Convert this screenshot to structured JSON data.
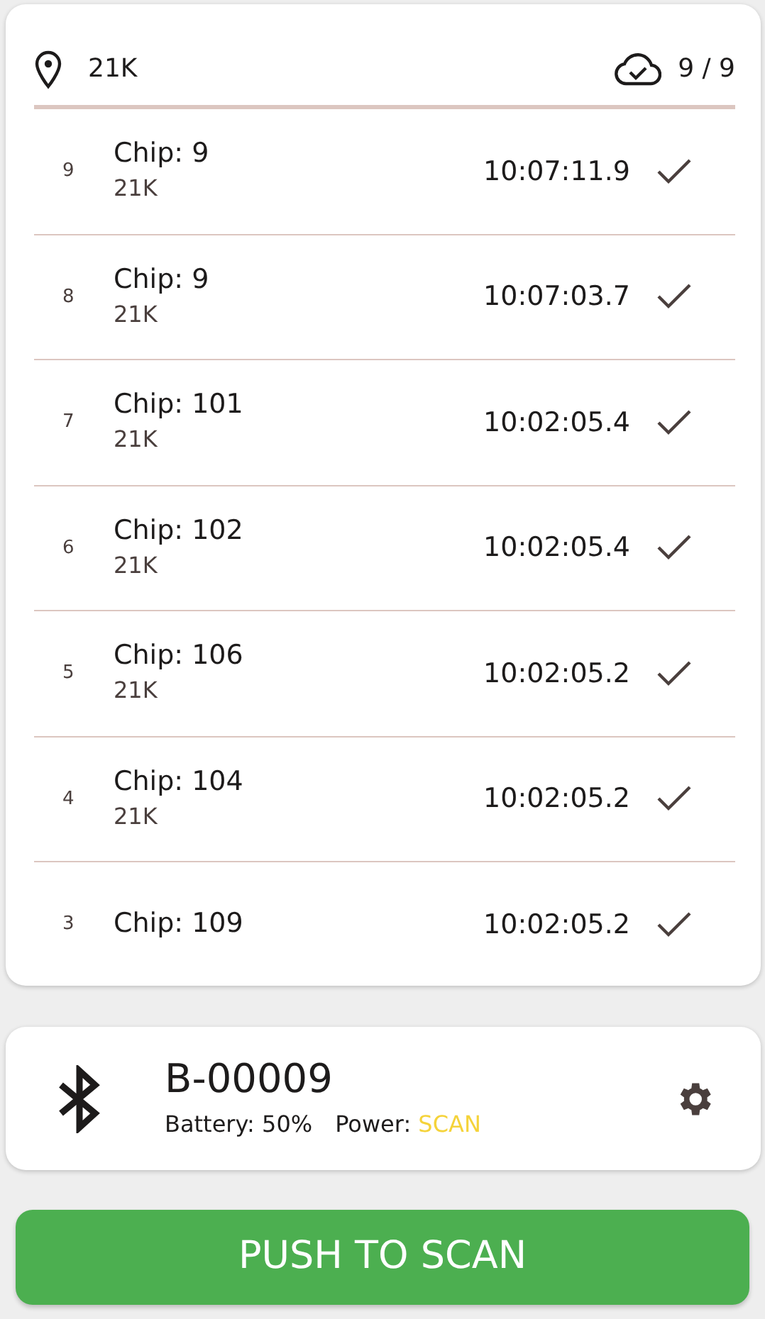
{
  "header": {
    "location": "21K",
    "sync_count": "9 / 9"
  },
  "reads": [
    {
      "index": "9",
      "chip": "Chip: 9",
      "location": "21K",
      "time": "10:07:11.9",
      "synced": true
    },
    {
      "index": "8",
      "chip": "Chip: 9",
      "location": "21K",
      "time": "10:07:03.7",
      "synced": true
    },
    {
      "index": "7",
      "chip": "Chip: 101",
      "location": "21K",
      "time": "10:02:05.4",
      "synced": true
    },
    {
      "index": "6",
      "chip": "Chip: 102",
      "location": "21K",
      "time": "10:02:05.4",
      "synced": true
    },
    {
      "index": "5",
      "chip": "Chip: 106",
      "location": "21K",
      "time": "10:02:05.2",
      "synced": true
    },
    {
      "index": "4",
      "chip": "Chip: 104",
      "location": "21K",
      "time": "10:02:05.2",
      "synced": true
    },
    {
      "index": "3",
      "chip": "Chip: 109",
      "time": "10:02:05.2",
      "synced": true
    }
  ],
  "device": {
    "name": "B-00009",
    "battery": "Battery: 50%",
    "power_label": "Power:",
    "power_value": "SCAN"
  },
  "scan_button": "PUSH TO SCAN"
}
